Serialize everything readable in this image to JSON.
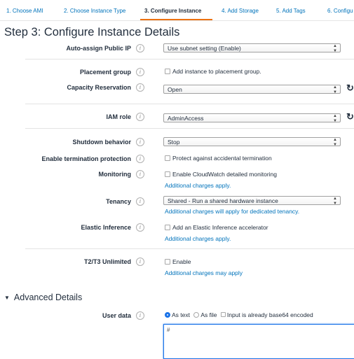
{
  "tabs": [
    {
      "label": "1. Choose AMI"
    },
    {
      "label": "2. Choose Instance Type"
    },
    {
      "label": "3. Configure Instance",
      "active": true
    },
    {
      "label": "4. Add Storage"
    },
    {
      "label": "5. Add Tags"
    },
    {
      "label": "6. Configu"
    }
  ],
  "page_title": "Step 3: Configure Instance Details",
  "fields": {
    "public_ip": {
      "label": "Auto-assign Public IP",
      "value": "Use subnet setting (Enable)"
    },
    "placement": {
      "label": "Placement group",
      "checkbox": "Add instance to placement group."
    },
    "capacity": {
      "label": "Capacity Reservation",
      "value": "Open"
    },
    "iam": {
      "label": "IAM role",
      "value": "AdminAccess"
    },
    "shutdown": {
      "label": "Shutdown behavior",
      "value": "Stop"
    },
    "termination": {
      "label": "Enable termination protection",
      "checkbox": "Protect against accidental termination"
    },
    "monitoring": {
      "label": "Monitoring",
      "checkbox": "Enable CloudWatch detailed monitoring",
      "link": "Additional charges apply."
    },
    "tenancy": {
      "label": "Tenancy",
      "value": "Shared - Run a shared hardware instance",
      "link": "Additional charges will apply for dedicated tenancy."
    },
    "inference": {
      "label": "Elastic Inference",
      "checkbox": "Add an Elastic Inference accelerator",
      "link": "Additional charges apply."
    },
    "t2t3": {
      "label": "T2/T3 Unlimited",
      "checkbox": "Enable",
      "link": "Additional charges may apply"
    }
  },
  "advanced": {
    "title": "Advanced Details",
    "user_data": {
      "label": "User data",
      "opt_text": "As text",
      "opt_file": "As file",
      "base64": "Input is already base64 encoded",
      "content": "#"
    }
  },
  "icons": {
    "info": "info-icon",
    "refresh": "refresh-icon",
    "select_arrows": "chevron-updown-icon",
    "collapse": "triangle-down-icon"
  },
  "colors": {
    "link": "#0073bb",
    "active_tab_underline": "#ec7211",
    "radio_selected": "#1a73e8"
  }
}
